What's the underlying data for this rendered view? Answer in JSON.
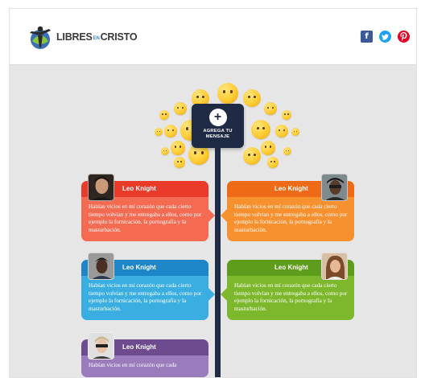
{
  "header": {
    "logo": {
      "part1": "LIBRES",
      "part2": "EN",
      "part3": "CRISTO"
    },
    "social": [
      {
        "name": "facebook-icon",
        "glyph": "f",
        "color": "#3b5998"
      },
      {
        "name": "twitter-icon",
        "glyph": "t",
        "color": "#1da1f2"
      },
      {
        "name": "pinterest-icon",
        "glyph": "p",
        "color": "#e60023"
      }
    ]
  },
  "center": {
    "button_glyph": "+",
    "label_line1": "AGREGA TU",
    "label_line2": "MENSAJE"
  },
  "cards": [
    {
      "name": "Leo Knight",
      "text": "Habían vicios en mí corazón que cada cierto tiempo volvían y me entregaba a ellos, como por ejemplo la fornicación, la pornografía y la masturbación.",
      "head_color": "#ea3a2a",
      "body_color": "#f46b52",
      "side": "left"
    },
    {
      "name": "Leo Knight",
      "text": "Habían vicios en mí corazón que cada cierto tiempo volvían y me entregaba a ellos, como por ejemplo la fornicación, la pornografía y la masturbación.",
      "head_color": "#ef6a16",
      "body_color": "#f7902e",
      "side": "right"
    },
    {
      "name": "Leo Knight",
      "text": "Habían vicios en mí corazón que cada cierto tiempo volvían y me entregaba a ellos, como por ejemplo la fornicación, la pornografía y la masturbación.",
      "head_color": "#1d86c9",
      "body_color": "#3aaee0",
      "side": "left"
    },
    {
      "name": "Leo Knight",
      "text": "Habían vicios en mí corazón que cada cierto tiempo volvían y me entregaba a ellos, como por ejemplo la fornicación, la pornografía y la masturbación.",
      "head_color": "#5e9c1c",
      "body_color": "#7db82c",
      "side": "right"
    },
    {
      "name": "Leo Knight",
      "text": "Habían vicios en mí corazón que cada",
      "head_color": "#6d4b8e",
      "body_color": "#9a7cbd",
      "side": "left"
    }
  ]
}
